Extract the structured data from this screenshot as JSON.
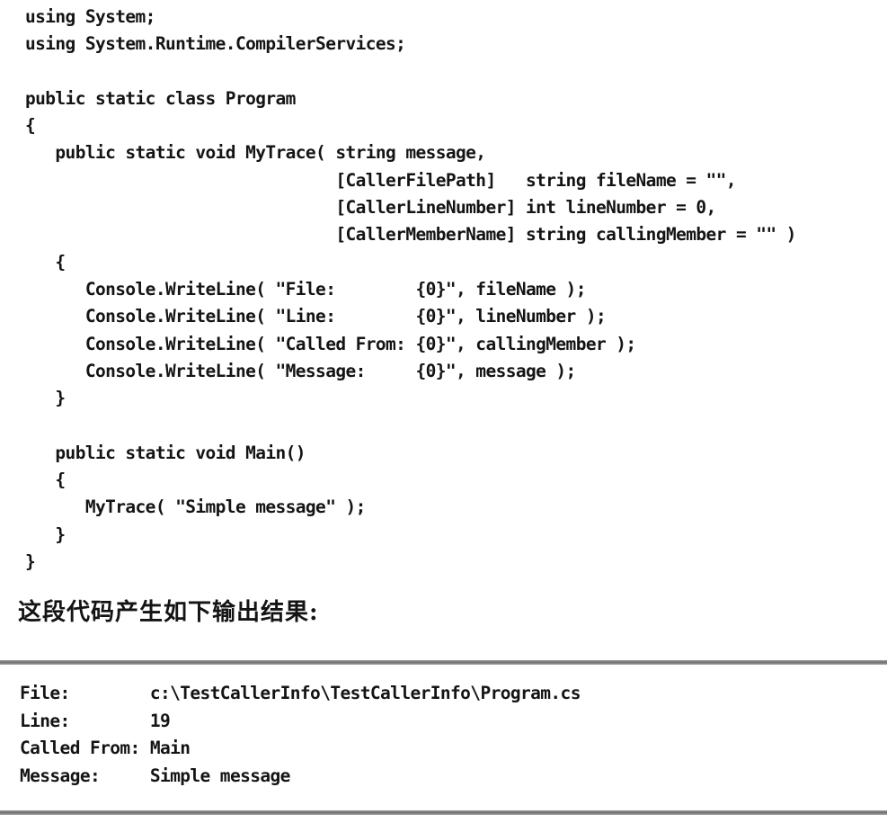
{
  "code": {
    "lines": [
      "using System;",
      "using System.Runtime.CompilerServices;",
      "",
      "public static class Program",
      "{",
      "   public static void MyTrace( string message,",
      "                               [CallerFilePath]   string fileName = \"\",",
      "                               [CallerLineNumber] int lineNumber = 0,",
      "                               [CallerMemberName] string callingMember = \"\" )",
      "   {",
      "      Console.WriteLine( \"File:        {0}\", fileName );",
      "      Console.WriteLine( \"Line:        {0}\", lineNumber );",
      "      Console.WriteLine( \"Called From: {0}\", callingMember );",
      "      Console.WriteLine( \"Message:     {0}\", message );",
      "   }",
      "",
      "   public static void Main()",
      "   {",
      "      MyTrace( \"Simple message\" );",
      "   }",
      "}"
    ]
  },
  "caption": "这段代码产生如下输出结果:",
  "output": {
    "lines": [
      "File:        c:\\TestCallerInfo\\TestCallerInfo\\Program.cs",
      "Line:        19",
      "Called From: Main",
      "Message:     Simple message"
    ]
  }
}
